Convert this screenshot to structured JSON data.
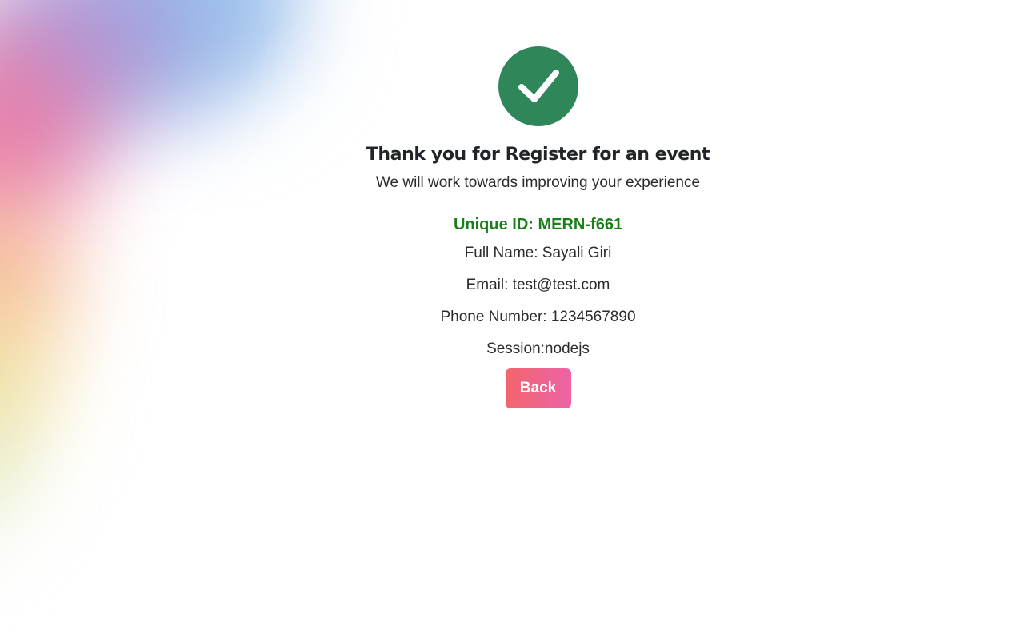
{
  "confirmation": {
    "title": "Thank you for Register for an event",
    "subtitle": "We will work towards improving your experience",
    "unique_id": "Unique ID: MERN-f661",
    "full_name": "Full Name: Sayali Giri",
    "email": "Email: test@test.com",
    "phone": "Phone Number: 1234567890",
    "session": "Session:nodejs",
    "back_label": "Back"
  },
  "icons": {
    "success": "check-circle-icon"
  },
  "colors": {
    "success_green": "#2e8659",
    "unique_id_green": "#1a7e1a",
    "button_gradient_start": "#f2656c",
    "button_gradient_end": "#ec64a6"
  }
}
